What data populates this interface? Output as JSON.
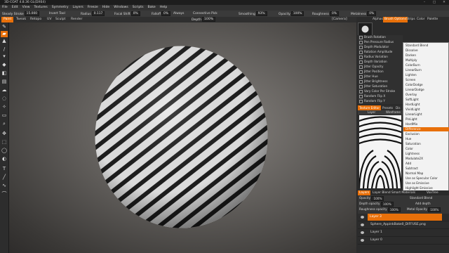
{
  "window": {
    "title": "3D-COAT 4.8.36 GL(DX64)",
    "controls": [
      "–",
      "□",
      "✕"
    ]
  },
  "menu": [
    "File",
    "Edit",
    "View",
    "Textures",
    "Symmetry",
    "Layers",
    "Freeze",
    "Hide",
    "Windows",
    "Scripts",
    "Bake",
    "Help"
  ],
  "options": {
    "steady_stroke_label": "Steady Stroke",
    "steady_stroke_value": "15.000",
    "invert_tool": "Invert Tool",
    "radius_label": "Radius",
    "radius_value": "0.117",
    "focal_shift_label": "Focal Shift",
    "focal_shift_value": "0%",
    "falloff_label": "Falloff",
    "falloff_value": "0%",
    "always": "Always",
    "connective_pick": "Connective Pick",
    "smoothing_label": "Smoothing",
    "smoothing_value": "93%",
    "opacity_label": "Opacity",
    "opacity_value": "100%",
    "roughness_label": "Roughness",
    "roughness_value": "0%",
    "metalness_label": "Metalness",
    "metalness_value": "0%",
    "depth_label": "Depth",
    "depth_value": "100%",
    "camera_label": "[Camera]"
  },
  "room_tabs": [
    "Paint",
    "Tweak",
    "Retopo",
    "UV",
    "Sculpt",
    "Render"
  ],
  "brush_tabs": [
    "Alphas",
    "Brush Options",
    "Strips",
    "Color",
    "Palette"
  ],
  "brush_options": [
    "Brush Rotation",
    "Pen Pressure Radius",
    "Depth Modulator",
    "Rotation Amplitude",
    "Radius Variation",
    "Depth Variation",
    "Jitter Opacity",
    "Jitter Position",
    "Jitter Hue",
    "Jitter Brightness",
    "Jitter Saturation",
    "Vary Color Per Stroke",
    "Random Flip X",
    "Random Flip Y"
  ],
  "texture": {
    "tabs": [
      "Texture Editor",
      "Presets",
      "Dis"
    ],
    "sub": [
      "Layer",
      "Wireframe"
    ]
  },
  "blend_modes": [
    "Standard Blend",
    "Dissolve",
    "Darken",
    "Multiply",
    "ColorBurn",
    "LinearBurn",
    "Lighten",
    "Screen",
    "ColorDodge",
    "LinearDodge",
    "Overlay",
    "SoftLight",
    "HardLight",
    "VividLight",
    "LinearLight",
    "PinLight",
    "HardMix",
    "Difference",
    "Exclusion",
    "Hue",
    "Saturation",
    "Color",
    "Lightness",
    "Modulate2X",
    "Add",
    "Subtract",
    "Normal Map",
    "Use as Specular Color",
    "Use as Emissive",
    "Highlight Emissive",
    "Divide"
  ],
  "selected_blend": "Difference",
  "layer_tabs": [
    "Layers",
    "Layer Blend",
    "Smart Materials",
    "VoxTree"
  ],
  "layer_props": {
    "opacity_label": "Opacity",
    "opacity_value": "100%",
    "blend_value": "Standard Blend",
    "depth_label": "Depth opacity",
    "depth_value": "100%",
    "add_depth": "Add depth",
    "rough_label": "Roughness opacity",
    "rough_value": "100%",
    "metal_label": "Metal Opacity",
    "metal_value": "100%"
  },
  "layers": [
    "Layer 3",
    "Sphere_AppinkBake0_DIFFUSE.png",
    "Layer 1",
    "Layer 0"
  ],
  "accent_color": "#e8700a"
}
